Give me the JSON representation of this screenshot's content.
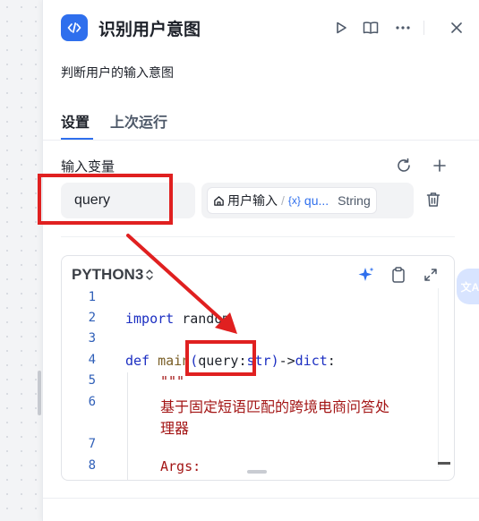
{
  "node": {
    "title": "识别用户意图",
    "description": "判断用户的输入意图"
  },
  "tabs": [
    {
      "label": "设置",
      "active": true
    },
    {
      "label": "上次运行",
      "active": false
    }
  ],
  "input_section": {
    "title": "输入变量",
    "variable": {
      "name": "query",
      "source_label": "用户输入",
      "separator": "/",
      "ref_prefix": "{x}",
      "ref_label": "qu...",
      "type": "String"
    }
  },
  "code": {
    "language": "PYTHON3",
    "language_arrow": "⌃",
    "line_numbers": [
      "1",
      "2",
      "3",
      "4",
      "5",
      "6",
      "7",
      "8"
    ],
    "line2": {
      "kw": "import",
      "rest": " random"
    },
    "line4": {
      "kw": "def",
      "fn": " main",
      "p1": "(",
      "param": "query",
      "colon": ":",
      "type": "str",
      "p2": ")",
      "arrow": "->",
      "ret": "dict",
      "end": ":"
    },
    "line5": "\"\"\"",
    "line6a": "基于固定短语匹配的跨境电商问答处",
    "line6b": "理器",
    "line8": "Args:"
  },
  "translate_button": "文A",
  "colors": {
    "accent": "#2f6fed",
    "annotation": "#e02020"
  }
}
